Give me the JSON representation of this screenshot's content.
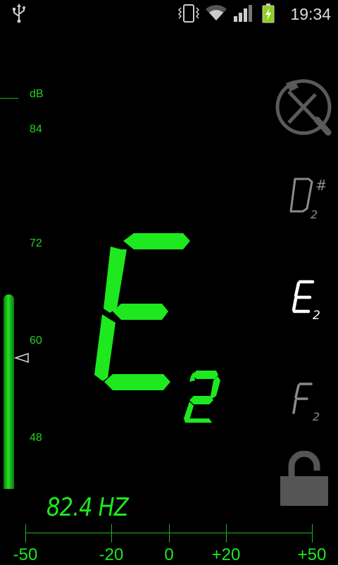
{
  "status_bar": {
    "time": "19:34",
    "icons": [
      "usb-icon",
      "vibrate-icon",
      "wifi-icon",
      "signal-icon",
      "battery-charging-icon"
    ]
  },
  "db_scale": {
    "unit": "dB",
    "labels": [
      "84",
      "72",
      "60",
      "48"
    ],
    "level_fraction": 0.6
  },
  "tuner": {
    "note": "E",
    "octave": "2",
    "frequency": "82.4 HZ"
  },
  "note_list": [
    {
      "note": "D",
      "accidental": "#",
      "octave": "2"
    },
    {
      "note": "E",
      "accidental": "",
      "octave": "2"
    },
    {
      "note": "F",
      "accidental": "",
      "octave": "2"
    }
  ],
  "cents_scale": {
    "labels": [
      "-50",
      "-20",
      "0",
      "+20",
      "+50"
    ]
  },
  "colors": {
    "accent_green": "#1ee81e",
    "dim_gray": "#8a8a8a",
    "background": "#000000"
  }
}
